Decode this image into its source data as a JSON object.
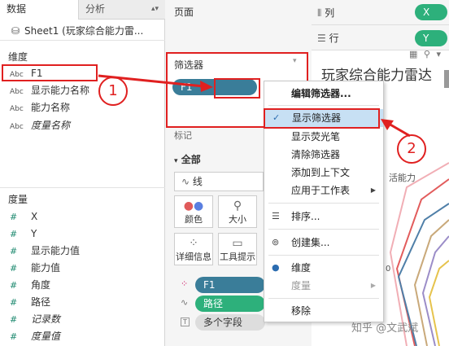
{
  "data_pane": {
    "tab_data": "数据",
    "tab_analysis": "分析",
    "datasource": "Sheet1 (玩家综合能力雷...",
    "dimensions_header": "维度",
    "dimensions": [
      {
        "type": "Abc",
        "name": "F1",
        "italic": false
      },
      {
        "type": "Abc",
        "name": "显示能力名称",
        "italic": false
      },
      {
        "type": "Abc",
        "name": "能力名称",
        "italic": false
      },
      {
        "type": "Abc",
        "name": "度量名称",
        "italic": true
      }
    ],
    "measures_header": "度量",
    "measures": [
      {
        "type": "#",
        "name": "X",
        "italic": false
      },
      {
        "type": "#",
        "name": "Y",
        "italic": false
      },
      {
        "type": "#",
        "name": "显示能力值",
        "italic": false
      },
      {
        "type": "#",
        "name": "能力值",
        "italic": false
      },
      {
        "type": "#",
        "name": "角度",
        "italic": false
      },
      {
        "type": "#",
        "name": "路径",
        "italic": false
      },
      {
        "type": "#",
        "name": "记录数",
        "italic": true
      },
      {
        "type": "#",
        "name": "度量值",
        "italic": true
      }
    ]
  },
  "middle": {
    "pages_label": "页面",
    "filters_label": "筛选器",
    "filter_pill": "F1",
    "marks_label": "标记",
    "all_label": "全部",
    "mark_type": "线",
    "mark_buttons": [
      "颜色",
      "大小",
      "详细信息",
      "工具提示"
    ],
    "shelf_pills": [
      "F1",
      "路径",
      "多个字段"
    ]
  },
  "shelves": {
    "columns_label": "列",
    "columns_pill": "X",
    "rows_label": "行",
    "rows_pill": "Y"
  },
  "canvas": {
    "title": "玩家综合能力雷达",
    "axis_label": "活能力",
    "axis_number": "0",
    "watermark": "知乎 @文武斌"
  },
  "context_menu": {
    "items": [
      {
        "label": "编辑筛选器...",
        "state": "normal",
        "bold": true
      },
      {
        "label": "显示筛选器",
        "state": "selected",
        "checked": true
      },
      {
        "label": "显示荧光笔",
        "state": "normal"
      },
      {
        "label": "清除筛选器",
        "state": "normal"
      },
      {
        "label": "添加到上下文",
        "state": "normal"
      },
      {
        "label": "应用于工作表",
        "state": "normal",
        "submenu": true
      },
      {
        "label": "排序...",
        "state": "normal"
      },
      {
        "label": "创建集...",
        "state": "normal"
      },
      {
        "label": "维度",
        "state": "normal",
        "dot": true
      },
      {
        "label": "度量",
        "state": "disabled",
        "submenu": true
      },
      {
        "label": "移除",
        "state": "normal"
      }
    ]
  },
  "annotations": {
    "badge1": "1",
    "badge2": "2"
  },
  "colors": {
    "accent_red": "#e02020",
    "pill_blue": "#3a7d99",
    "pill_green": "#2db07b",
    "menu_selected": "#c7e0f4"
  },
  "chart_lines": [
    {
      "color": "#c9a97a"
    },
    {
      "color": "#9b8dc8"
    },
    {
      "color": "#4f7fa8"
    },
    {
      "color": "#e6c34d"
    },
    {
      "color": "#f1aeb5"
    },
    {
      "color": "#e25c5c"
    }
  ]
}
